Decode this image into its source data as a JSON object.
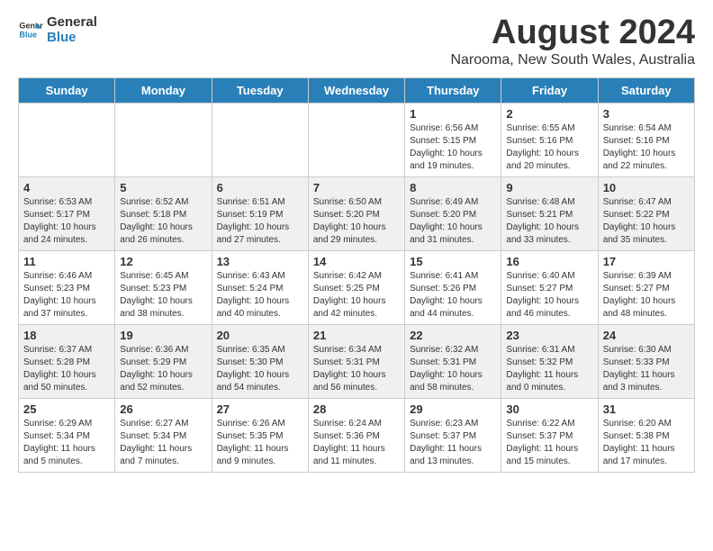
{
  "logo": {
    "line1": "General",
    "line2": "Blue"
  },
  "title": "August 2024",
  "subtitle": "Narooma, New South Wales, Australia",
  "days_of_week": [
    "Sunday",
    "Monday",
    "Tuesday",
    "Wednesday",
    "Thursday",
    "Friday",
    "Saturday"
  ],
  "weeks": [
    [
      {
        "day": "",
        "info": ""
      },
      {
        "day": "",
        "info": ""
      },
      {
        "day": "",
        "info": ""
      },
      {
        "day": "",
        "info": ""
      },
      {
        "day": "1",
        "info": "Sunrise: 6:56 AM\nSunset: 5:15 PM\nDaylight: 10 hours\nand 19 minutes."
      },
      {
        "day": "2",
        "info": "Sunrise: 6:55 AM\nSunset: 5:16 PM\nDaylight: 10 hours\nand 20 minutes."
      },
      {
        "day": "3",
        "info": "Sunrise: 6:54 AM\nSunset: 5:16 PM\nDaylight: 10 hours\nand 22 minutes."
      }
    ],
    [
      {
        "day": "4",
        "info": "Sunrise: 6:53 AM\nSunset: 5:17 PM\nDaylight: 10 hours\nand 24 minutes."
      },
      {
        "day": "5",
        "info": "Sunrise: 6:52 AM\nSunset: 5:18 PM\nDaylight: 10 hours\nand 26 minutes."
      },
      {
        "day": "6",
        "info": "Sunrise: 6:51 AM\nSunset: 5:19 PM\nDaylight: 10 hours\nand 27 minutes."
      },
      {
        "day": "7",
        "info": "Sunrise: 6:50 AM\nSunset: 5:20 PM\nDaylight: 10 hours\nand 29 minutes."
      },
      {
        "day": "8",
        "info": "Sunrise: 6:49 AM\nSunset: 5:20 PM\nDaylight: 10 hours\nand 31 minutes."
      },
      {
        "day": "9",
        "info": "Sunrise: 6:48 AM\nSunset: 5:21 PM\nDaylight: 10 hours\nand 33 minutes."
      },
      {
        "day": "10",
        "info": "Sunrise: 6:47 AM\nSunset: 5:22 PM\nDaylight: 10 hours\nand 35 minutes."
      }
    ],
    [
      {
        "day": "11",
        "info": "Sunrise: 6:46 AM\nSunset: 5:23 PM\nDaylight: 10 hours\nand 37 minutes."
      },
      {
        "day": "12",
        "info": "Sunrise: 6:45 AM\nSunset: 5:23 PM\nDaylight: 10 hours\nand 38 minutes."
      },
      {
        "day": "13",
        "info": "Sunrise: 6:43 AM\nSunset: 5:24 PM\nDaylight: 10 hours\nand 40 minutes."
      },
      {
        "day": "14",
        "info": "Sunrise: 6:42 AM\nSunset: 5:25 PM\nDaylight: 10 hours\nand 42 minutes."
      },
      {
        "day": "15",
        "info": "Sunrise: 6:41 AM\nSunset: 5:26 PM\nDaylight: 10 hours\nand 44 minutes."
      },
      {
        "day": "16",
        "info": "Sunrise: 6:40 AM\nSunset: 5:27 PM\nDaylight: 10 hours\nand 46 minutes."
      },
      {
        "day": "17",
        "info": "Sunrise: 6:39 AM\nSunset: 5:27 PM\nDaylight: 10 hours\nand 48 minutes."
      }
    ],
    [
      {
        "day": "18",
        "info": "Sunrise: 6:37 AM\nSunset: 5:28 PM\nDaylight: 10 hours\nand 50 minutes."
      },
      {
        "day": "19",
        "info": "Sunrise: 6:36 AM\nSunset: 5:29 PM\nDaylight: 10 hours\nand 52 minutes."
      },
      {
        "day": "20",
        "info": "Sunrise: 6:35 AM\nSunset: 5:30 PM\nDaylight: 10 hours\nand 54 minutes."
      },
      {
        "day": "21",
        "info": "Sunrise: 6:34 AM\nSunset: 5:31 PM\nDaylight: 10 hours\nand 56 minutes."
      },
      {
        "day": "22",
        "info": "Sunrise: 6:32 AM\nSunset: 5:31 PM\nDaylight: 10 hours\nand 58 minutes."
      },
      {
        "day": "23",
        "info": "Sunrise: 6:31 AM\nSunset: 5:32 PM\nDaylight: 11 hours\nand 0 minutes."
      },
      {
        "day": "24",
        "info": "Sunrise: 6:30 AM\nSunset: 5:33 PM\nDaylight: 11 hours\nand 3 minutes."
      }
    ],
    [
      {
        "day": "25",
        "info": "Sunrise: 6:29 AM\nSunset: 5:34 PM\nDaylight: 11 hours\nand 5 minutes."
      },
      {
        "day": "26",
        "info": "Sunrise: 6:27 AM\nSunset: 5:34 PM\nDaylight: 11 hours\nand 7 minutes."
      },
      {
        "day": "27",
        "info": "Sunrise: 6:26 AM\nSunset: 5:35 PM\nDaylight: 11 hours\nand 9 minutes."
      },
      {
        "day": "28",
        "info": "Sunrise: 6:24 AM\nSunset: 5:36 PM\nDaylight: 11 hours\nand 11 minutes."
      },
      {
        "day": "29",
        "info": "Sunrise: 6:23 AM\nSunset: 5:37 PM\nDaylight: 11 hours\nand 13 minutes."
      },
      {
        "day": "30",
        "info": "Sunrise: 6:22 AM\nSunset: 5:37 PM\nDaylight: 11 hours\nand 15 minutes."
      },
      {
        "day": "31",
        "info": "Sunrise: 6:20 AM\nSunset: 5:38 PM\nDaylight: 11 hours\nand 17 minutes."
      }
    ]
  ]
}
